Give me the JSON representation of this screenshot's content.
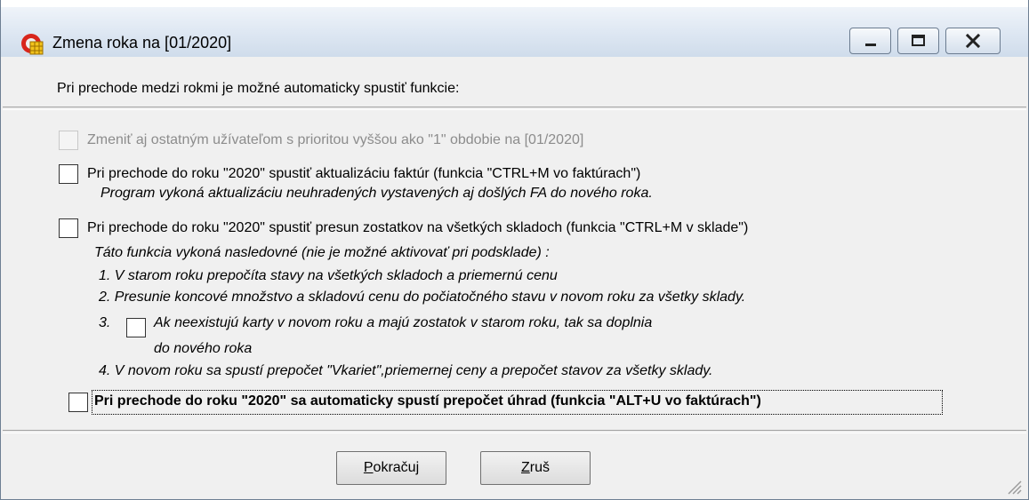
{
  "window": {
    "title": "Zmena roka na [01/2020]",
    "icon": "app-logo-icon",
    "controls": [
      "minimize-icon",
      "maximize-icon",
      "close-icon"
    ]
  },
  "intro": "Pri prechode medzi rokmi je možné automaticky spustiť funkcie:",
  "options": {
    "other_users": "Zmeniť aj ostatným užívateľom s prioritou vyššou ako \"1\" obdobie na [01/2020]",
    "invoices": "Pri prechode do roku \"2020\" spustiť aktualizáciu faktúr (funkcia \"CTRL+M vo faktúrach\")",
    "invoices_note": "Program vykoná aktualizáciu neuhradených vystavených aj došlých FA do nového roka.",
    "stock": "Pri prechode do roku \"2020\" spustiť presun zostatkov na všetkých skladoch (funkcia \"CTRL+M v sklade\")",
    "stock_note": "Táto funkcia vykoná nasledovné (nie je možné aktivovať pri podsklade) :",
    "stock_step1": "1. V starom roku prepočíta stavy na všetkých skladoch a priemernú cenu",
    "stock_step2": "2. Presunie koncové množstvo a skladovú cenu do počiatočného stavu v novom roku za všetky sklady.",
    "stock_step3_num": "3.",
    "stock_step3_line1": "Ak neexistujú karty v novom roku a majú zostatok v starom roku, tak sa doplnia",
    "stock_step3_line2": "do nového roka",
    "stock_step4": "4. V novom roku sa spustí prepočet \"Vkariet\",priemernej ceny a  prepočet stavov  za všetky sklady.",
    "payments": "Pri prechode do roku \"2020\" sa automaticky spustí prepočet úhrad (funkcia \"ALT+U vo faktúrach\")"
  },
  "checked": {
    "other_users": false,
    "invoices": false,
    "stock": false,
    "stock_step3": false,
    "payments": false
  },
  "buttons": {
    "continue_mnemonic": "P",
    "continue_rest": "okračuj",
    "cancel_mnemonic": "Z",
    "cancel_rest": "ruš"
  },
  "colors": {
    "disabled_text": "#8c8c8c",
    "window_bg": "#f0f0f0"
  }
}
